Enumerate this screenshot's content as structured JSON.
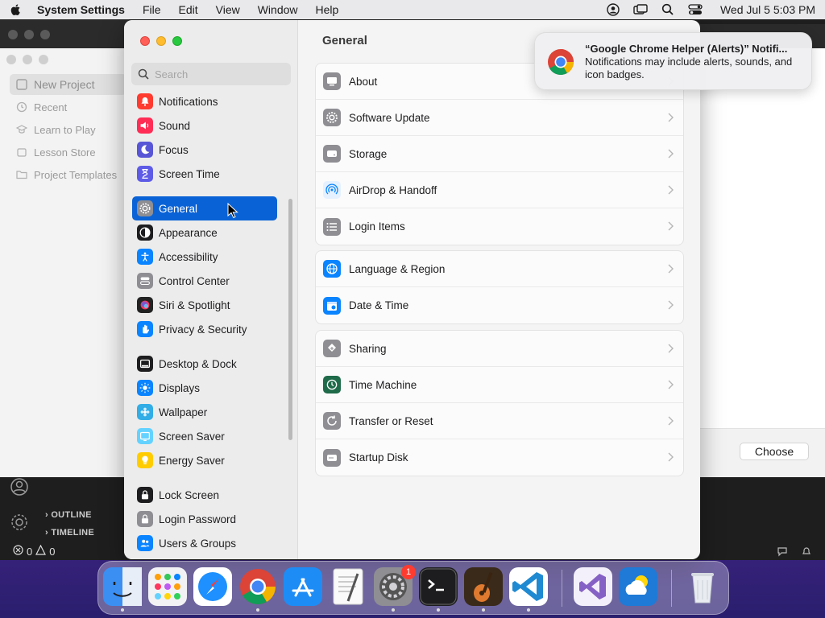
{
  "menubar": {
    "app_name": "System Settings",
    "items": [
      "File",
      "Edit",
      "View",
      "Window",
      "Help"
    ],
    "clock": "Wed Jul 5  5:03 PM",
    "icons": [
      "user-account-icon",
      "screen-mirroring-icon",
      "spotlight-search-icon",
      "control-center-icon"
    ]
  },
  "background_app": {
    "sidebar_items": [
      "New Project",
      "Recent",
      "Learn to Play",
      "Lesson Store",
      "Project Templates"
    ],
    "outline_label": "OUTLINE",
    "timeline_label": "TIMELINE",
    "status_errors": "0",
    "status_warnings": "0",
    "choose_button": "Choose"
  },
  "settings": {
    "search_placeholder": "Search",
    "sidebar": {
      "items": [
        {
          "label": "Notifications",
          "icon": "bell-icon",
          "color": "#ff3b30"
        },
        {
          "label": "Sound",
          "icon": "speaker-icon",
          "color": "#ff2d55"
        },
        {
          "label": "Focus",
          "icon": "moon-icon",
          "color": "#5856d6"
        },
        {
          "label": "Screen Time",
          "icon": "hourglass-icon",
          "color": "#5e5ce6"
        },
        {
          "label": "General",
          "icon": "gear-icon",
          "color": "#8e8e93",
          "selected": true
        },
        {
          "label": "Appearance",
          "icon": "appearance-icon",
          "color": "#1d1d1f"
        },
        {
          "label": "Accessibility",
          "icon": "accessibility-icon",
          "color": "#0a84ff"
        },
        {
          "label": "Control Center",
          "icon": "control-center-icon",
          "color": "#8e8e93"
        },
        {
          "label": "Siri & Spotlight",
          "icon": "siri-icon",
          "color": "#bf5af2"
        },
        {
          "label": "Privacy & Security",
          "icon": "hand-icon",
          "color": "#0a84ff"
        },
        {
          "label": "Desktop & Dock",
          "icon": "dock-icon",
          "color": "#1d1d1f"
        },
        {
          "label": "Displays",
          "icon": "sun-icon",
          "color": "#0a84ff"
        },
        {
          "label": "Wallpaper",
          "icon": "wallpaper-icon",
          "color": "#32ade6"
        },
        {
          "label": "Screen Saver",
          "icon": "screen-saver-icon",
          "color": "#64d2ff"
        },
        {
          "label": "Energy Saver",
          "icon": "lightbulb-icon",
          "color": "#ffcc00"
        },
        {
          "label": "Lock Screen",
          "icon": "lock-icon",
          "color": "#1d1d1f"
        },
        {
          "label": "Login Password",
          "icon": "key-lock-icon",
          "color": "#8e8e93"
        },
        {
          "label": "Users & Groups",
          "icon": "users-icon",
          "color": "#0a84ff"
        }
      ]
    },
    "content": {
      "title": "General",
      "groups": [
        [
          {
            "label": "About",
            "icon": "computer-icon",
            "color": "#8e8e93"
          },
          {
            "label": "Software Update",
            "icon": "gear-badge-icon",
            "color": "#8e8e93"
          },
          {
            "label": "Storage",
            "icon": "drive-icon",
            "color": "#8e8e93"
          },
          {
            "label": "AirDrop & Handoff",
            "icon": "airdrop-icon",
            "color": "#0a84ff"
          },
          {
            "label": "Login Items",
            "icon": "list-icon",
            "color": "#8e8e93"
          }
        ],
        [
          {
            "label": "Language & Region",
            "icon": "globe-icon",
            "color": "#0a84ff"
          },
          {
            "label": "Date & Time",
            "icon": "calendar-clock-icon",
            "color": "#0a84ff"
          }
        ],
        [
          {
            "label": "Sharing",
            "icon": "sharing-icon",
            "color": "#8e8e93"
          },
          {
            "label": "Time Machine",
            "icon": "time-machine-icon",
            "color": "#1f6b4a"
          },
          {
            "label": "Transfer or Reset",
            "icon": "reset-icon",
            "color": "#8e8e93"
          },
          {
            "label": "Startup Disk",
            "icon": "disk-icon",
            "color": "#8e8e93"
          }
        ]
      ]
    }
  },
  "notification": {
    "title": "“Google Chrome Helper (Alerts)” Notifi...",
    "body": "Notifications may include alerts, sounds, and icon badges.",
    "icon": "chrome-icon"
  },
  "dock": {
    "apps": [
      {
        "name": "Finder",
        "icon": "finder-icon",
        "running": true
      },
      {
        "name": "Launchpad",
        "icon": "launchpad-icon",
        "running": false
      },
      {
        "name": "Safari",
        "icon": "safari-icon",
        "running": false
      },
      {
        "name": "Google Chrome",
        "icon": "chrome-icon",
        "running": true
      },
      {
        "name": "App Store",
        "icon": "app-store-icon",
        "running": false
      },
      {
        "name": "TextEdit",
        "icon": "textedit-icon",
        "running": false
      },
      {
        "name": "System Settings",
        "icon": "system-settings-icon",
        "running": true,
        "badge": "1"
      },
      {
        "name": "Terminal",
        "icon": "terminal-icon",
        "running": true
      },
      {
        "name": "GarageBand",
        "icon": "garageband-icon",
        "running": true
      },
      {
        "name": "Visual Studio Code",
        "icon": "vscode-icon",
        "running": true
      },
      {
        "name": "Visual Studio",
        "icon": "visual-studio-icon",
        "running": false
      },
      {
        "name": "Weather",
        "icon": "weather-icon",
        "running": false
      },
      {
        "name": "Trash",
        "icon": "trash-icon",
        "running": false
      }
    ]
  }
}
